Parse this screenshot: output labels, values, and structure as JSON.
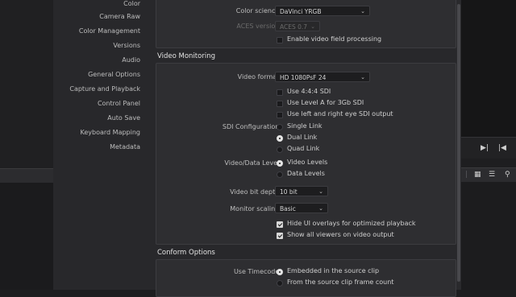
{
  "sidebar": {
    "items": [
      "Color",
      "Camera Raw",
      "Color Management",
      "Versions",
      "Audio",
      "General Options",
      "Capture and Playback",
      "Control Panel",
      "Auto Save",
      "Keyboard Mapping",
      "Metadata"
    ]
  },
  "color_section": {
    "color_science_label": "Color science:",
    "color_science_value": "DaVinci YRGB",
    "aces_version_label": "ACES version:",
    "aces_version_value": "ACES 0.7",
    "field_processing_label": "Enable video field processing"
  },
  "video_monitoring": {
    "title": "Video Monitoring",
    "video_format_label": "Video format:",
    "video_format_value": "HD 1080PsF 24",
    "options": [
      "Use 4:4:4 SDI",
      "Use Level A for 3Gb SDI",
      "Use left and right eye SDI output"
    ],
    "sdi_config_label": "SDI Configuration:",
    "sdi_options": [
      "Single Link",
      "Dual Link",
      "Quad Link"
    ],
    "sdi_selected": "Dual Link",
    "data_level_label": "Video/Data Level:",
    "data_level_options": [
      "Video Levels",
      "Data Levels"
    ],
    "data_level_selected": "Video Levels",
    "bit_depth_label": "Video bit depth:",
    "bit_depth_value": "10 bit",
    "monitor_scaling_label": "Monitor scaling:",
    "monitor_scaling_value": "Basic",
    "hide_overlays_label": "Hide UI overlays for optimized playback",
    "show_viewers_label": "Show all viewers on video output"
  },
  "conform_options": {
    "title": "Conform Options",
    "use_timecode_label": "Use Timecode:",
    "timecode_options": [
      "Embedded in the source clip",
      "From the source clip frame count"
    ],
    "timecode_selected": "Embedded in the source clip"
  },
  "icons": {
    "chevron": "⌄",
    "play_next": "▶|",
    "prev": "|◀",
    "grid": "▦",
    "list": "☰",
    "search": "⚲"
  }
}
